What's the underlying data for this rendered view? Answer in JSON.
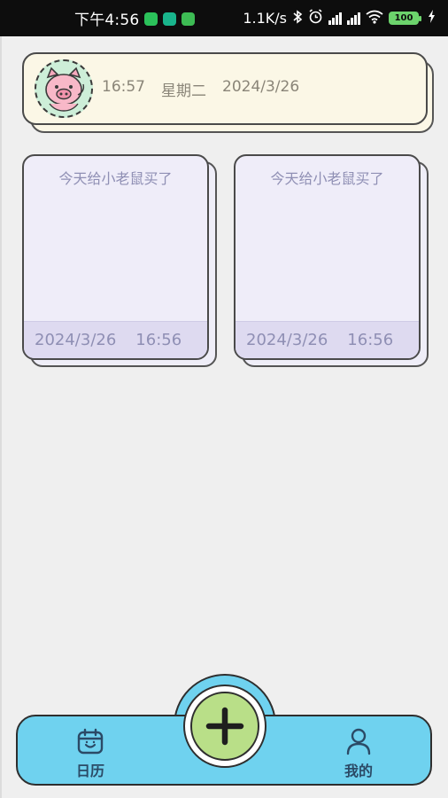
{
  "status_bar": {
    "time": "下午4:56",
    "network_speed": "1.1K/s",
    "battery": "100",
    "icons": [
      "wechat-icon",
      "app-icon",
      "app-icon",
      "bluetooth-icon",
      "alarm-icon",
      "signal-icon",
      "signal-icon",
      "wifi-icon",
      "battery-icon",
      "charging-icon"
    ]
  },
  "header": {
    "avatar": "pig-icon",
    "time": "16:57",
    "weekday": "星期二",
    "date": "2024/3/26"
  },
  "notes": [
    {
      "title": "今天给小老鼠买了",
      "date": "2024/3/26",
      "time": "16:56"
    },
    {
      "title": "今天给小老鼠买了",
      "date": "2024/3/26",
      "time": "16:56"
    }
  ],
  "bottom_nav": {
    "calendar_label": "日历",
    "add_button": "plus-icon",
    "profile_label": "我的"
  },
  "colors": {
    "nav_bg": "#6fd2ef",
    "fab_bg": "#b9df88",
    "header_bg": "#fbf7e6",
    "note_bg": "#efedf9",
    "note_footer": "#dedaf0"
  }
}
